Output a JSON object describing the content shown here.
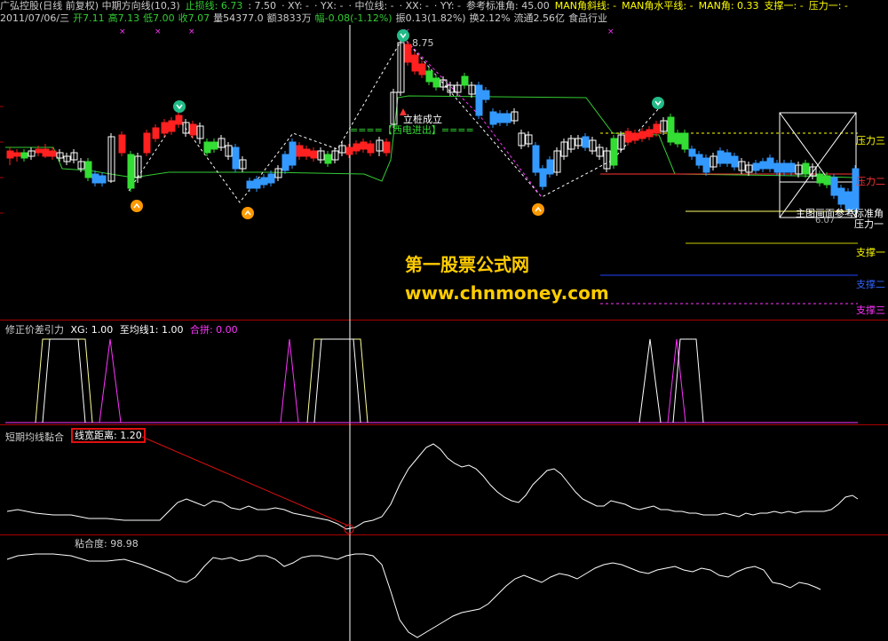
{
  "header": {
    "line1": [
      {
        "text": "广弘控股(日线 前复权) 中期方向线(10,3)",
        "color": "#cccccc"
      },
      {
        "text": "止损线: 6.73",
        "color": "#33cc33"
      },
      {
        "text": ": 7.50",
        "color": "#cccccc"
      },
      {
        "text": "· XY: -",
        "color": "#cccccc"
      },
      {
        "text": "· YX: -",
        "color": "#cccccc"
      },
      {
        "text": "· 中位线: -",
        "color": "#cccccc"
      },
      {
        "text": "· XX: -",
        "color": "#cccccc"
      },
      {
        "text": "· YY: -",
        "color": "#cccccc"
      },
      {
        "text": "参考标准角: 45.00",
        "color": "#cccccc"
      },
      {
        "text": "MAN角斜线: -",
        "color": "#ffff00"
      },
      {
        "text": "MAN角水平线: -",
        "color": "#ffff00"
      },
      {
        "text": "MAN角: 0.33",
        "color": "#ffff00"
      },
      {
        "text": "支撑一: -",
        "color": "#ffff00"
      },
      {
        "text": "压力一: -",
        "color": "#ffff00"
      }
    ],
    "line2": [
      {
        "text": "2011/07/06/三",
        "color": "#cccccc"
      },
      {
        "text": "开7.11",
        "color": "#33cc33"
      },
      {
        "text": "高7.13",
        "color": "#33cc33"
      },
      {
        "text": "低7.00",
        "color": "#33cc33"
      },
      {
        "text": "收7.07",
        "color": "#33cc33"
      },
      {
        "text": "量54377.0",
        "color": "#cccccc"
      },
      {
        "text": "额3833万",
        "color": "#cccccc"
      },
      {
        "text": "幅-0.08(-1.12%)",
        "color": "#33cc33"
      },
      {
        "text": "振0.13(1.82%)",
        "color": "#cccccc"
      },
      {
        "text": "换2.12%",
        "color": "#cccccc"
      },
      {
        "text": "流通2.56亿",
        "color": "#cccccc"
      },
      {
        "text": "食品行业",
        "color": "#cccccc"
      }
    ]
  },
  "main_chart": {
    "peak_label": "8.75",
    "pile_label": "立桩成立",
    "signal_label": "====【西电进出】====",
    "right_labels": {
      "pressure3": "压力三",
      "pressure2": "压力二",
      "pressure1": "压力一",
      "support1": "支撑一",
      "support2": "支撑二",
      "support3": "支撑三",
      "reference_note": "主图画面参考标准角",
      "price_small": "6.07"
    }
  },
  "watermark": {
    "line1": "第一股票公式网",
    "line2": "www.chnmoney.com"
  },
  "panel2": {
    "title": "修正价差引力",
    "xg": "XG: 1.00",
    "ma1": "至均线1: 1.00",
    "combo": "合拼: 0.00"
  },
  "panel3": {
    "title": "短期均线黏合",
    "distance": "线宽距离: 1.20"
  },
  "panel4": {
    "title": "粘合度: 98.98"
  },
  "colors": {
    "red": "#ff2020",
    "green": "#33dd33",
    "blue": "#3399ff",
    "yellow": "#ffff00",
    "magenta": "#ff33ff",
    "border": "#aa0000",
    "watermark": "#ffcc00"
  }
}
